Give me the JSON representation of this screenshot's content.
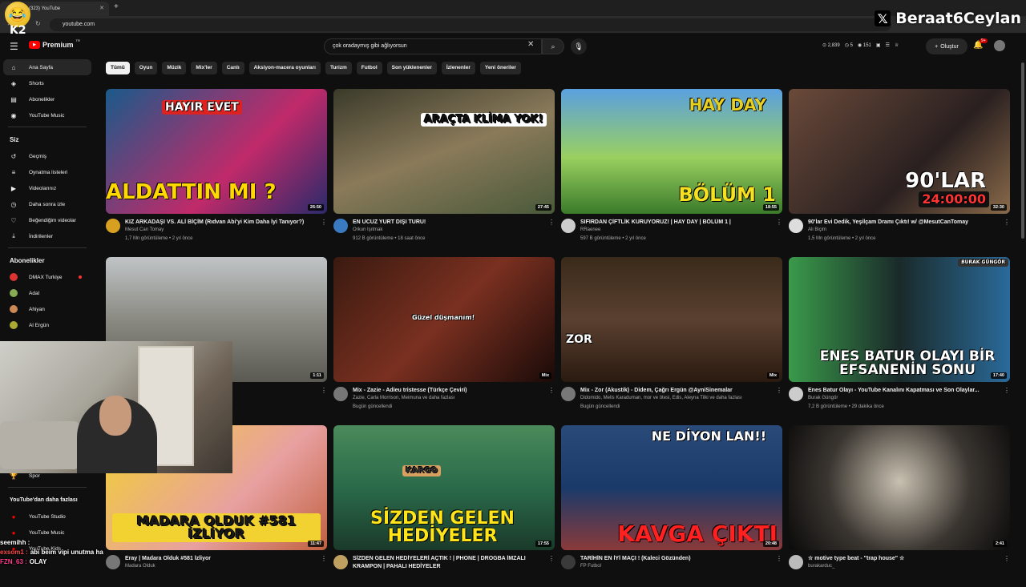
{
  "browser": {
    "tab_title": "(323) YouTube",
    "new_tab": "+",
    "url": "youtube.com"
  },
  "stream_overlay": {
    "channel_badge": "K2",
    "twitter_handle": "Beraat6Ceylan",
    "chat": [
      {
        "user": "seemihh :",
        "message": "",
        "color": "#ffffff"
      },
      {
        "user": "exsom1 :",
        "message": "abi beim vipi unutma ha",
        "color": "#ff4a4a"
      },
      {
        "user": "FZN_63 :",
        "message": "OLAY",
        "color": "#ff3b8b"
      }
    ]
  },
  "header": {
    "logo_text": "Premium",
    "logo_tr": "TR",
    "search_query": "çok oradaymış gibi ağlıyorsun",
    "stats": [
      "2,839",
      "5",
      "151"
    ],
    "create_label": "Oluştur",
    "notif_badge": "9+"
  },
  "sidebar": {
    "main": [
      {
        "label": "Ana Sayfa",
        "icon": "home-icon",
        "active": true
      },
      {
        "label": "Shorts",
        "icon": "shorts-icon"
      },
      {
        "label": "Abonelikler",
        "icon": "subscriptions-icon"
      },
      {
        "label": "YouTube Music",
        "icon": "music-icon"
      }
    ],
    "you_header": "Siz",
    "you": [
      {
        "label": "Geçmiş",
        "icon": "history-icon"
      },
      {
        "label": "Oynatma listeleri",
        "icon": "playlist-icon"
      },
      {
        "label": "Videolarınız",
        "icon": "your-videos-icon"
      },
      {
        "label": "Daha sonra izle",
        "icon": "watch-later-icon"
      },
      {
        "label": "Beğendiğim videolar",
        "icon": "like-icon"
      },
      {
        "label": "İndirilenler",
        "icon": "download-icon"
      }
    ],
    "subs_header": "Abonelikler",
    "subs": [
      {
        "label": "DMAX Turkiye",
        "color": "#d33"
      },
      {
        "label": "Adal",
        "color": "#8a5"
      },
      {
        "label": "Ahiyan",
        "color": "#c85"
      },
      {
        "label": "Al Ergün",
        "color": "#aa3"
      }
    ],
    "spor": "Spor",
    "more_header": "YouTube'dan daha fazlası",
    "more": [
      {
        "label": "YouTube Studio"
      },
      {
        "label": "YouTube Music"
      },
      {
        "label": "YouTube Kids"
      }
    ]
  },
  "chips": [
    "Tümü",
    "Oyun",
    "Müzik",
    "Mix'ler",
    "Canlı",
    "Aksiyon-macera oyunları",
    "Turizm",
    "Futbol",
    "Son yüklenenler",
    "İzlenenler",
    "Yeni öneriler"
  ],
  "videos": [
    {
      "title": "KIZ ARKADAŞI VS. ALİ BİÇİM (Rıdvan Abi'yi Kim Daha İyi Tanıyor?)",
      "channel": "Mesut Can Tomay",
      "views": "1,7 Mn görüntüleme • 2 yıl önce",
      "duration": "26:50",
      "overlay": "ALDATTIN MI ?",
      "overlay2": "HAYIR  EVET"
    },
    {
      "title": "EN UCUZ YURT DIŞI TURU!",
      "channel": "Orkun Işıtmak",
      "views": "912 B görüntüleme • 18 saat önce",
      "duration": "27:45",
      "overlay": "ARAÇTA KLİMA YOK!",
      "overlay2": ""
    },
    {
      "title": "SIFIRDAN ÇİFTLİK KURUYORUZ! | HAY DAY | BÖLÜM 1 |",
      "channel": "RRaenee",
      "views": "597 B görüntüleme • 2 yıl önce",
      "duration": "18:55",
      "overlay": "BÖLÜM 1",
      "overlay2": "HAY DAY"
    },
    {
      "title": "90'lar Evi Dedik, Yeşilçam Dramı Çıktı! w/ @MesutCanTomay",
      "channel": "Ali Biçim",
      "views": "1,5 Mn görüntüleme • 2 yıl önce",
      "duration": "32:30",
      "overlay": "90'LAR",
      "overlay2": "24:00:00"
    },
    {
      "title": "...vem",
      "channel": "",
      "views": "",
      "duration": "1:11",
      "overlay": "",
      "overlay2": ""
    },
    {
      "title": "Mix - Zazie - Adieu tristesse (Türkçe Çeviri)",
      "channel": "Zazie, Carla Morrison, Meimuna ve daha fazlası",
      "views": "Bugün güncellendi",
      "duration": "Mix",
      "overlay": "Güzel düşmanım!",
      "overlay2": ""
    },
    {
      "title": "Mix - Zor (Akustik) - Didem, Çağrı Ergün @AyniSinemalar",
      "channel": "Didomido, Melis Karaduman, mor ve ötesi, Edis, Aleyna Tilki ve daha fazlası",
      "views": "Bugün güncellendi",
      "duration": "Mix",
      "overlay": "ZOR",
      "overlay2": ""
    },
    {
      "title": "Enes Batur Olayı - YouTube Kanalını Kapatması ve Son Olaylar...",
      "channel": "Burak Güngör",
      "views": "7,2 B görüntüleme • 29 dakika önce",
      "duration": "17:40",
      "overlay": "ENES BATUR OLAYI BİR EFSANENİN SONU",
      "overlay2": "BURAK GÜNGÖR"
    },
    {
      "title": "Eray | Madara Olduk #581 İzliyor",
      "channel": "Madara Olduk",
      "views": "",
      "duration": "11:47",
      "overlay": "MADARA OLDUK #581 İZLİYOR",
      "overlay2": ""
    },
    {
      "title": "SİZDEN GELEN HEDİYELERİ AÇTIK ! | PHONE | DROGBA İMZALI KRAMPON | PAHALI HEDİYELER",
      "channel": "",
      "views": "",
      "duration": "17:55",
      "overlay": "SİZDEN GELEN HEDİYELER",
      "overlay2": "KARGO"
    },
    {
      "title": "TARİHİN EN İYİ MAÇI ! (Kaleci Gözünden)",
      "channel": "FP Futbol",
      "views": "",
      "duration": "20:48",
      "overlay": "KAVGA ÇIKTI",
      "overlay2": "NE DİYON LAN!!"
    },
    {
      "title": "☆ motive type beat - \"trap house\" ☆",
      "channel": "burakarduc_",
      "views": "",
      "duration": "2:41",
      "overlay": "",
      "overlay2": ""
    }
  ]
}
